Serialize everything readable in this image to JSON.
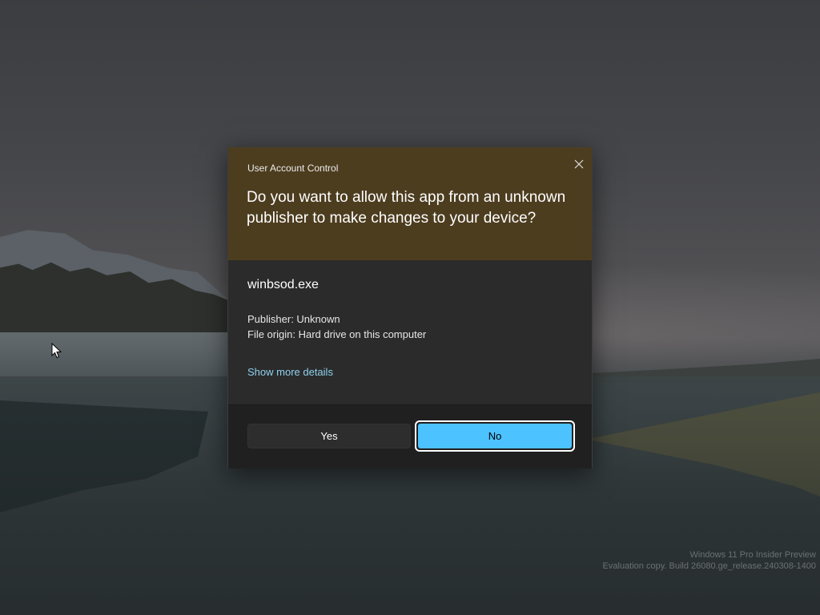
{
  "uac": {
    "title": "User Account Control",
    "question": "Do you want to allow this app from an unknown publisher to make changes to your device?",
    "app_name": "winbsod.exe",
    "publisher": "Publisher: Unknown",
    "file_origin": "File origin: Hard drive on this computer",
    "details_link": "Show more details",
    "yes_label": "Yes",
    "no_label": "No",
    "close_icon": "close-icon",
    "focused_button": "No"
  },
  "watermark": {
    "line1": "Windows 11 Pro Insider Preview",
    "line2": "Evaluation copy. Build 26080.ge_release.240308-1400"
  },
  "colors": {
    "header_bg": "#4d3d1f",
    "body_bg": "#2b2b2b",
    "footer_bg": "#202020",
    "accent": "#4cc2ff",
    "link": "#8ed1ee"
  }
}
